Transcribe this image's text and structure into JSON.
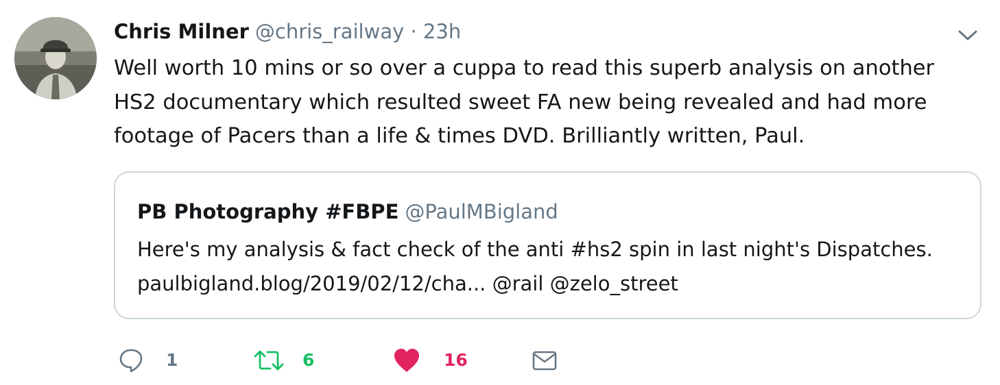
{
  "tweet": {
    "author_name": "Chris Milner",
    "author_handle": "@chris_railway",
    "separator": "·",
    "timestamp": "23h",
    "text": "Well worth 10 mins or so over a cuppa to read this superb analysis on another HS2 documentary which resulted sweet FA new being revealed and had more footage of Pacers than a life & times DVD. Brilliantly written, Paul."
  },
  "quoted_tweet": {
    "author_name": "PB Photography #FBPE",
    "author_handle": "@PaulMBigland",
    "text": "Here's my analysis & fact check of the anti #hs2 spin in last night's Dispatches. paulbigland.blog/2019/02/12/cha... @rail @zelo_street"
  },
  "actions": {
    "reply_count": "1",
    "retweet_count": "6",
    "like_count": "16"
  },
  "icons": {
    "menu": "chevron-down-icon",
    "reply": "speech-bubble-icon",
    "retweet": "retweet-arrows-icon",
    "like": "heart-icon",
    "dm": "envelope-icon"
  },
  "colors": {
    "text": "#14171a",
    "muted": "#657786",
    "border": "#ccd6dd",
    "retweet_active": "#17bf63",
    "like_active": "#e0245e"
  }
}
